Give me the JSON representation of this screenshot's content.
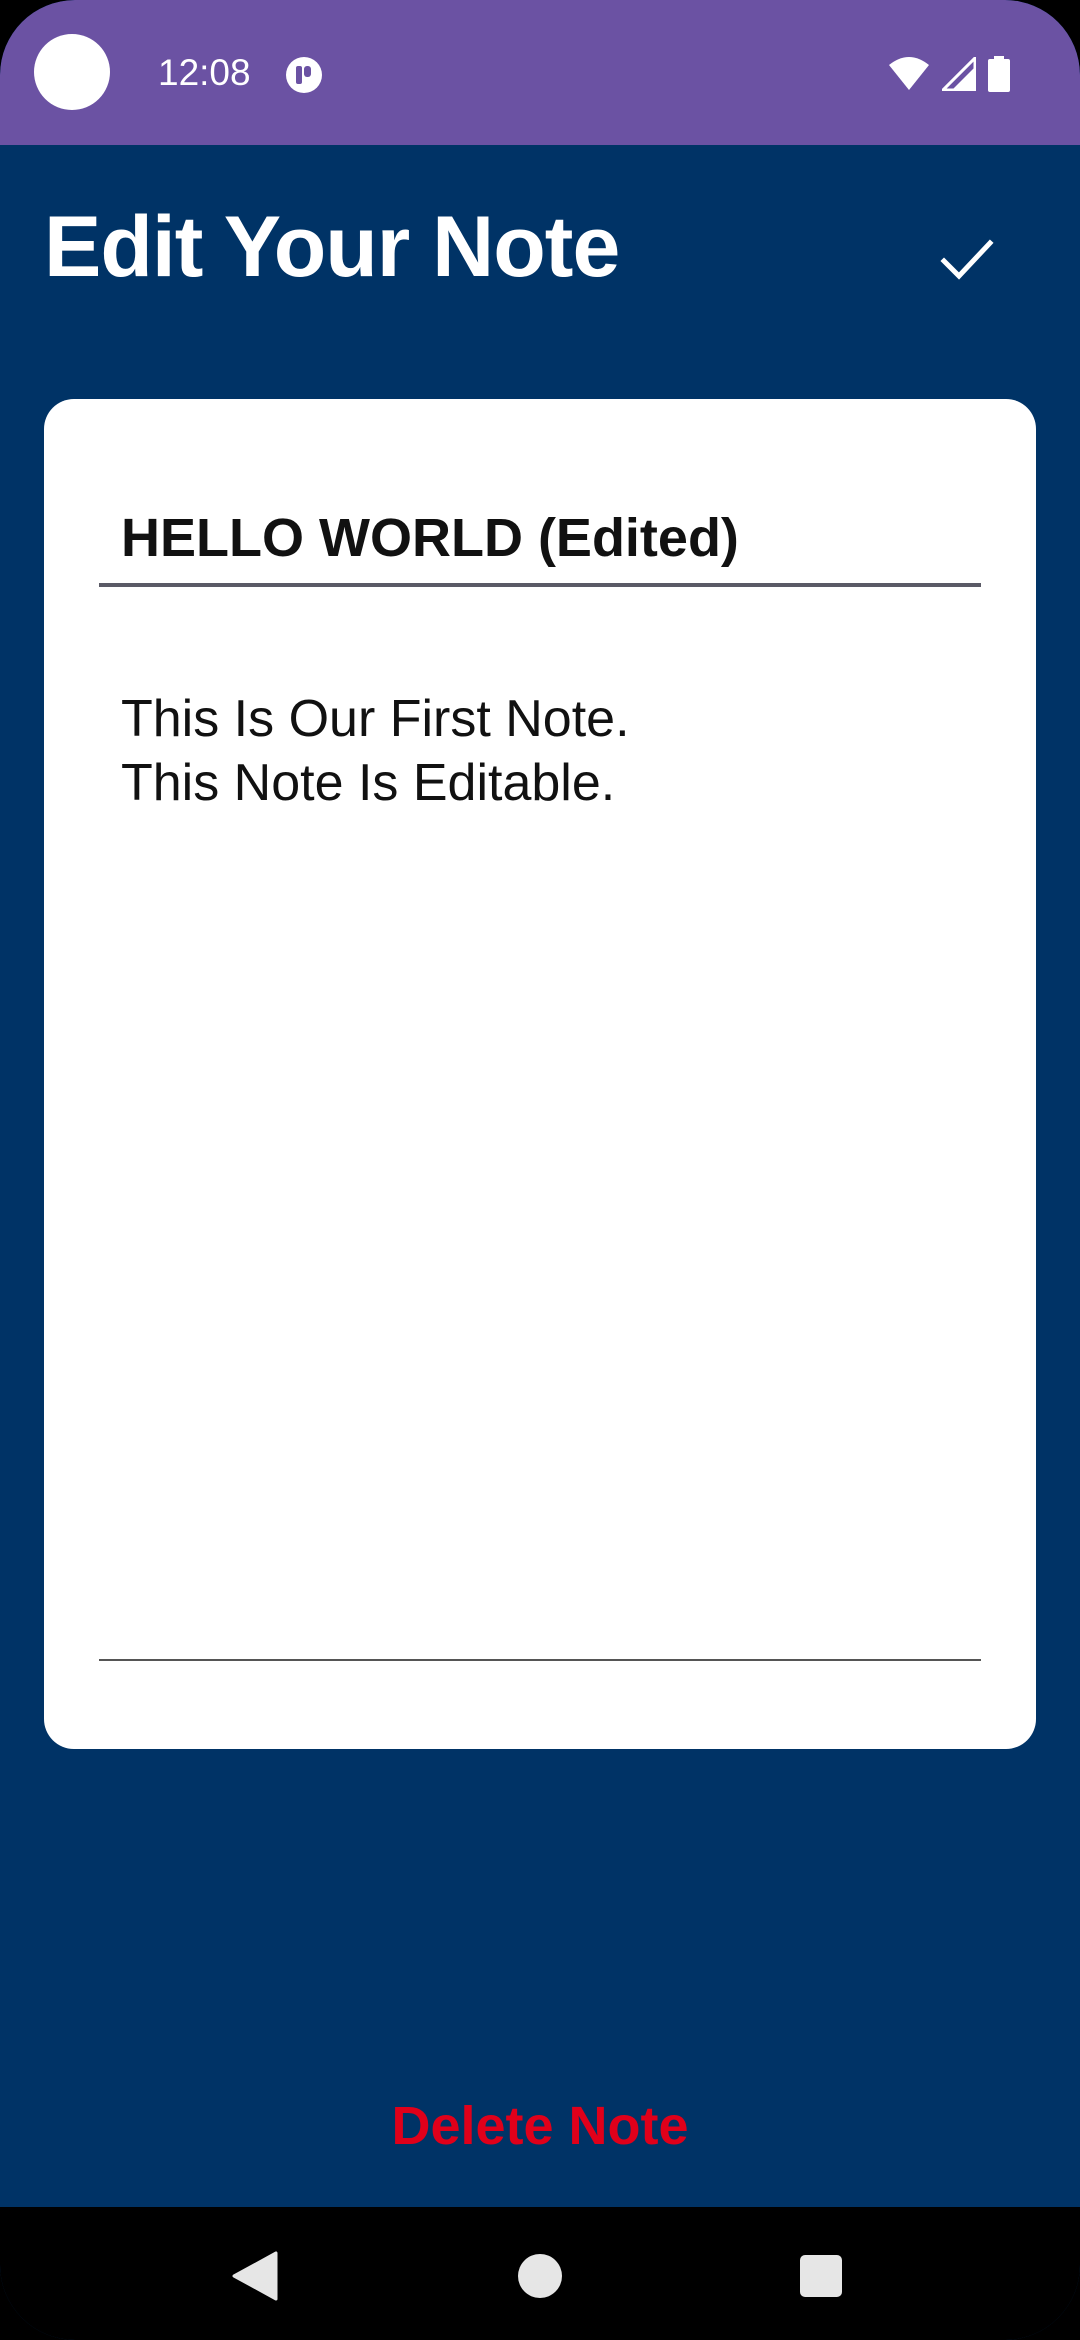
{
  "status_bar": {
    "time": "12:08",
    "icons": [
      "camera-cutout",
      "app-notification-icon",
      "wifi-icon",
      "cellular-signal-icon",
      "battery-icon"
    ]
  },
  "app_bar": {
    "title": "Edit Your Note",
    "save_icon": "checkmark-icon"
  },
  "note": {
    "title_value": "HELLO WORLD (Edited)",
    "body_lines": [
      "This Is Our First Note.",
      "This Note Is Editable."
    ]
  },
  "actions": {
    "delete_label": "Delete Note"
  },
  "nav_bar": {
    "icons": [
      "back-icon",
      "home-icon",
      "recents-icon"
    ]
  },
  "colors": {
    "status_bar": "#6B52A3",
    "background": "#003366",
    "card": "#FFFFFF",
    "delete": "#E0001A"
  }
}
